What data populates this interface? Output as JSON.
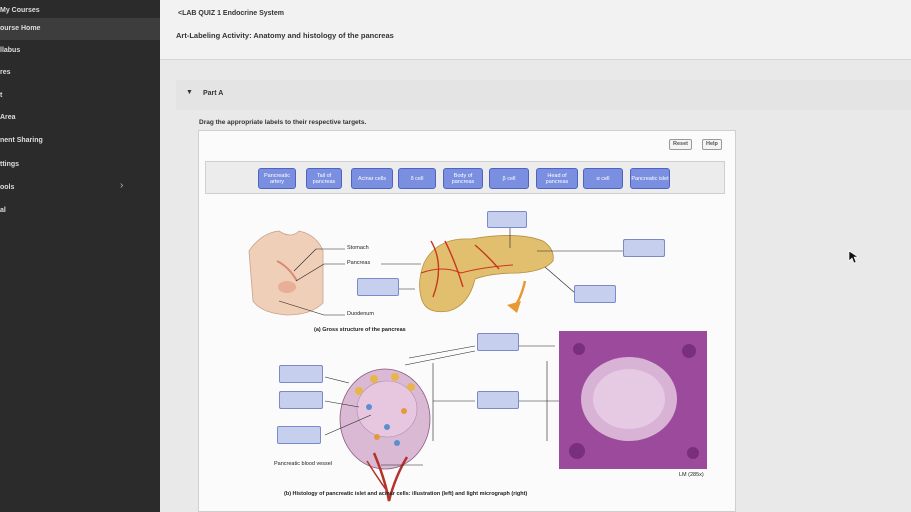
{
  "sidebar": {
    "items": [
      {
        "label": "My Courses"
      },
      {
        "label": "ourse Home"
      },
      {
        "label": "llabus"
      },
      {
        "label": "res"
      },
      {
        "label": "t"
      },
      {
        "label": "Area"
      },
      {
        "label": "nent Sharing"
      },
      {
        "label": "ttings"
      },
      {
        "label": "ools"
      },
      {
        "label": "al"
      }
    ]
  },
  "header": {
    "back_link": "<LAB QUIZ 1 Endocrine System",
    "activity_title": "Art-Labeling Activity: Anatomy and histology of the pancreas"
  },
  "part": {
    "label": "Part A"
  },
  "instructions": "Drag the appropriate labels to their respective targets.",
  "toolbar": {
    "reset": "Reset",
    "help": "Help"
  },
  "labels": [
    "Pancreatic artery",
    "Tail of pancreas",
    "Acinar cells",
    "δ cell",
    "Body of pancreas",
    "β cell",
    "Head of pancreas",
    "α cell",
    "Pancreatic islet"
  ],
  "figure": {
    "stomach": "Stomach",
    "pancreas": "Pancreas",
    "duodenum": "Duodenum",
    "caption_a": "(a) Gross structure of the pancreas",
    "blood_vessel": "Pancreatic blood vessel",
    "magnification": "LM (285x)",
    "caption_b": "(b) Histology of pancreatic islet and acinar cells: illustration (left) and light micrograph (right)"
  },
  "colors": {
    "chip": "#7b8fe0",
    "target": "#c7cfee",
    "sidebar": "#2b2b2b"
  }
}
